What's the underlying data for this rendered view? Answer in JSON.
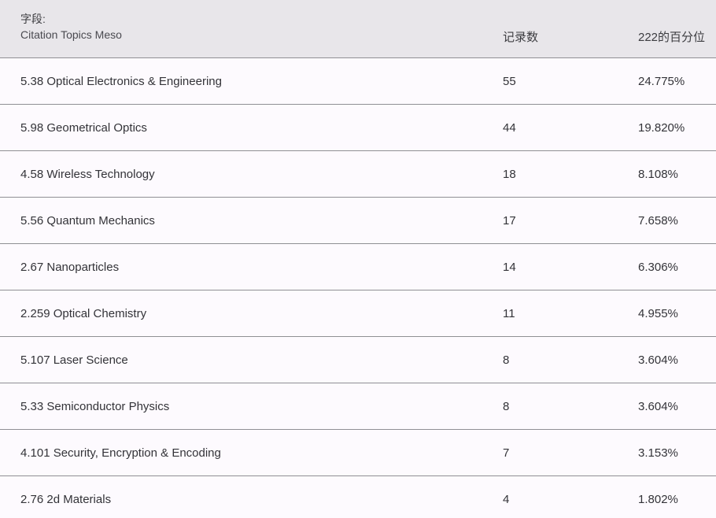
{
  "header": {
    "field_prefix": "字段:",
    "field_name": "Citation Topics Meso",
    "count_label": "记录数",
    "percent_label": "222的百分位"
  },
  "rows": [
    {
      "topic": "5.38 Optical Electronics & Engineering",
      "count": "55",
      "percent": "24.775%"
    },
    {
      "topic": "5.98 Geometrical Optics",
      "count": "44",
      "percent": "19.820%"
    },
    {
      "topic": "4.58 Wireless Technology",
      "count": "18",
      "percent": "8.108%"
    },
    {
      "topic": "5.56 Quantum Mechanics",
      "count": "17",
      "percent": "7.658%"
    },
    {
      "topic": "2.67 Nanoparticles",
      "count": "14",
      "percent": "6.306%"
    },
    {
      "topic": "2.259 Optical Chemistry",
      "count": "11",
      "percent": "4.955%"
    },
    {
      "topic": "5.107 Laser Science",
      "count": "8",
      "percent": "3.604%"
    },
    {
      "topic": "5.33 Semiconductor Physics",
      "count": "8",
      "percent": "3.604%"
    },
    {
      "topic": "4.101 Security, Encryption & Encoding",
      "count": "7",
      "percent": "3.153%"
    },
    {
      "topic": "2.76 2d Materials",
      "count": "4",
      "percent": "1.802%"
    }
  ]
}
